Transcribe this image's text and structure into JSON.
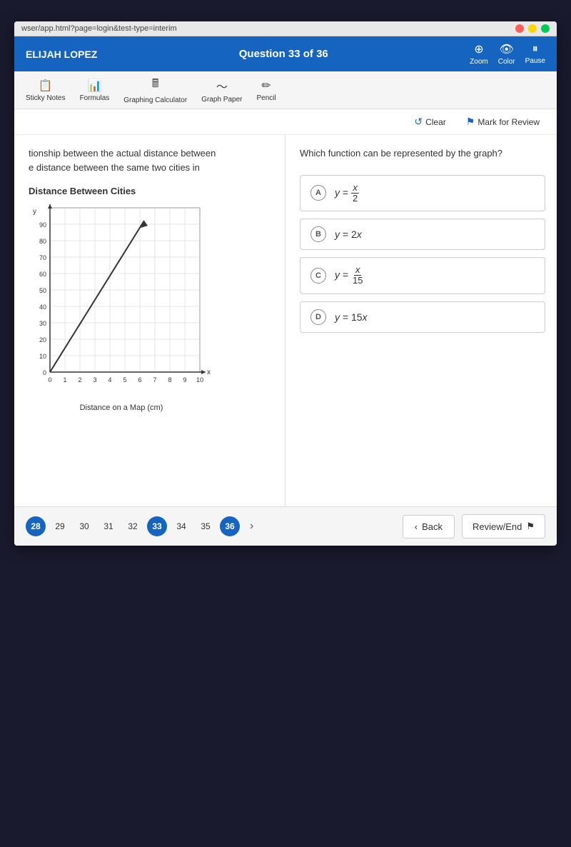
{
  "browser": {
    "url": "wser/app.html?page=login&test-type=interim"
  },
  "header": {
    "student_name": "ELIJAH LOPEZ",
    "question_title": "Question 33 of 36",
    "tools": [
      {
        "label": "Zoom",
        "icon": "⊕"
      },
      {
        "label": "Color",
        "icon": "👁"
      },
      {
        "label": "Pause",
        "icon": "⏸"
      }
    ]
  },
  "toolbar": {
    "items": [
      {
        "label": "Sticky Notes",
        "icon": "📋"
      },
      {
        "label": "Formulas",
        "icon": "📊"
      },
      {
        "label": "Graphing Calculator",
        "icon": "🖩"
      },
      {
        "label": "Graph Paper",
        "icon": "〜"
      },
      {
        "label": "Pencil",
        "icon": "✏"
      }
    ]
  },
  "action_bar": {
    "clear_label": "Clear",
    "mark_for_review_label": "Mark for Review"
  },
  "left_panel": {
    "question_text_line1": "tionship between the actual distance between",
    "question_text_line2": "e distance between the same two cities in",
    "graph_title": "Distance Between Cities",
    "y_axis_label": "y",
    "x_axis_label": "Distance on a Map (cm)",
    "y_axis_numbers": [
      "10",
      "20",
      "30",
      "40",
      "50",
      "60",
      "70",
      "80",
      "90",
      "0"
    ],
    "x_axis_numbers": [
      "0",
      "1",
      "2",
      "3",
      "4",
      "5",
      "6",
      "7",
      "8",
      "9",
      "10"
    ]
  },
  "right_panel": {
    "question_text": "Which function can be represented by the graph?",
    "answers": [
      {
        "label": "A",
        "text": "y = x/2"
      },
      {
        "label": "B",
        "text": "y = 2x"
      },
      {
        "label": "C",
        "text": "y = x/15"
      },
      {
        "label": "D",
        "text": "y = 15x"
      }
    ]
  },
  "bottom_nav": {
    "pages": [
      {
        "num": "28",
        "active": false,
        "highlighted": true
      },
      {
        "num": "29",
        "active": false
      },
      {
        "num": "30",
        "active": false
      },
      {
        "num": "31",
        "active": false
      },
      {
        "num": "32",
        "active": false
      },
      {
        "num": "33",
        "active": true
      },
      {
        "num": "34",
        "active": false
      },
      {
        "num": "35",
        "active": false
      },
      {
        "num": "36",
        "active": false,
        "highlighted": true
      }
    ],
    "back_label": "Back",
    "review_end_label": "Review/End"
  }
}
